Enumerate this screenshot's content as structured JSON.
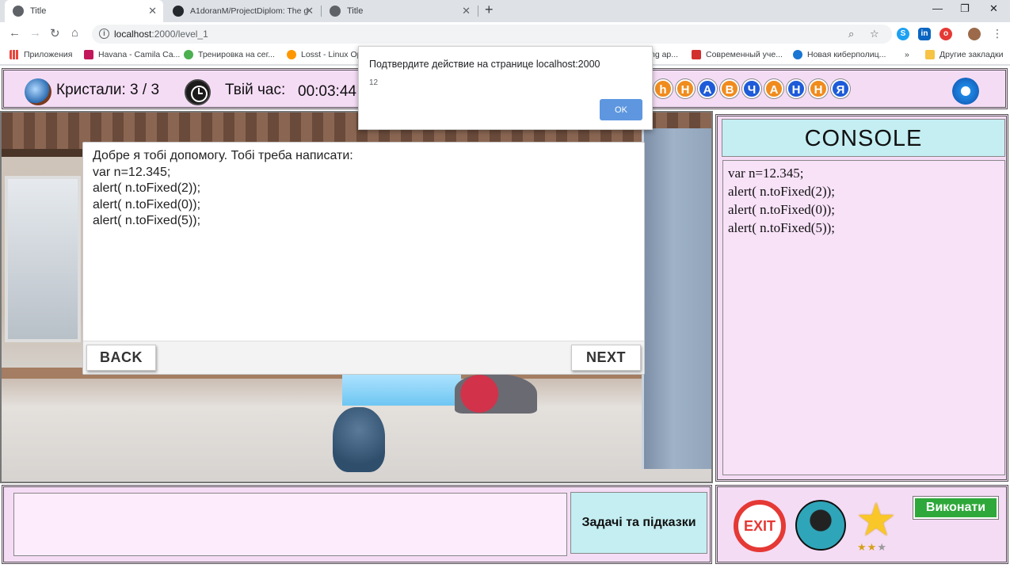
{
  "browser": {
    "tabs": [
      {
        "title": "Title",
        "active": true
      },
      {
        "title": "A1doranM/ProjectDiplom: The g",
        "active": false
      },
      {
        "title": "Title",
        "active": false
      }
    ],
    "url": {
      "host": "localhost",
      "rest": ":2000/level_1"
    },
    "bookmarks": [
      {
        "label": "Приложения",
        "color": "#e8453c"
      },
      {
        "label": "Havana - Camila Ca...",
        "color": "#c2185b"
      },
      {
        "label": "Тренировка на сег...",
        "color": "#4caf50"
      },
      {
        "label": "Losst - Linux Op",
        "color": "#ff9800"
      },
      {
        "label": "ng ap...",
        "color": "#ffffff"
      },
      {
        "label": "Современный уче...",
        "color": "#d32f2f"
      },
      {
        "label": "Новая киберполиц...",
        "color": "#1976d2"
      },
      {
        "label": "»",
        "color": "#ffffff"
      },
      {
        "label": "Другие закладки",
        "color": "#f6c344"
      }
    ]
  },
  "game": {
    "crystals_text": "Кристали: 3 /  3",
    "time_label": "Твій час:",
    "time_value": "00:03:44",
    "letters": [
      {
        "char": "h",
        "color": "#f08c1e"
      },
      {
        "char": "Н",
        "color": "#f08c1e"
      },
      {
        "char": "А",
        "color": "#1e5bd8"
      },
      {
        "char": "В",
        "color": "#f08c1e"
      },
      {
        "char": "Ч",
        "color": "#1e5bd8"
      },
      {
        "char": "А",
        "color": "#f08c1e"
      },
      {
        "char": "Н",
        "color": "#1e5bd8"
      },
      {
        "char": "Н",
        "color": "#f08c1e"
      },
      {
        "char": "Я",
        "color": "#1e5bd8"
      }
    ],
    "dialog": {
      "text": "Добре я тобі допомогу. Тобі треба написати:\nvar n=12.345;\nalert( n.toFixed(2));\nalert( n.toFixed(0));\nalert( n.toFixed(5));",
      "back_label": "BACK",
      "next_label": "NEXT"
    },
    "console": {
      "title": "CONSOLE",
      "text": "var n=12.345;\nalert( n.toFixed(2));\nalert( n.toFixed(0));\nalert( n.toFixed(5));"
    },
    "tasks_label": "Задачі та підказки",
    "exit_label": "EXIT",
    "run_label": "Виконати",
    "stars": {
      "filled": 2,
      "total": 3
    }
  },
  "alert": {
    "title": "Подтвердите действие на странице localhost:2000",
    "message": "12",
    "ok_label": "OK"
  }
}
